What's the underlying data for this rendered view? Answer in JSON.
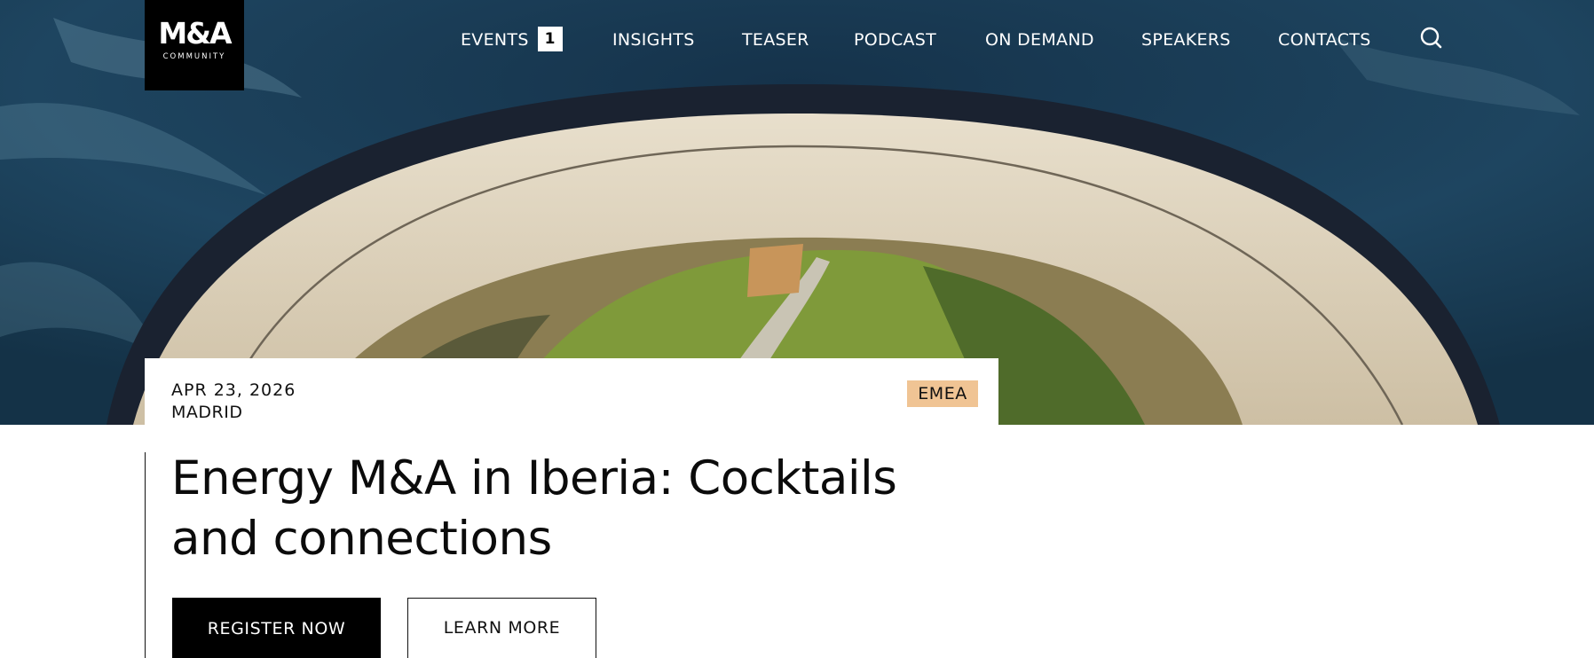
{
  "brand": {
    "logo_mark": "M&A",
    "logo_sub": "COMMUNITY"
  },
  "nav": {
    "items": [
      {
        "label": "EVENTS",
        "badge": "1"
      },
      {
        "label": "INSIGHTS"
      },
      {
        "label": "TEASER"
      },
      {
        "label": "PODCAST"
      },
      {
        "label": "ON DEMAND"
      },
      {
        "label": "SPEAKERS"
      },
      {
        "label": "CONTACTS"
      }
    ],
    "search_icon": "search-icon"
  },
  "event": {
    "date": "APR 23, 2026",
    "city": "MADRID",
    "region_tag": "EMEA",
    "title": "Energy M&A in Iberia: Cocktails and connections",
    "register_label": "REGISTER NOW",
    "learn_more_label": "LEARN MORE"
  },
  "colors": {
    "accent_tag": "#f0c494",
    "button_primary": "#000000",
    "water": "#1b3d52",
    "dam": "#d9cdb6",
    "grass": "#7f9a3a"
  }
}
